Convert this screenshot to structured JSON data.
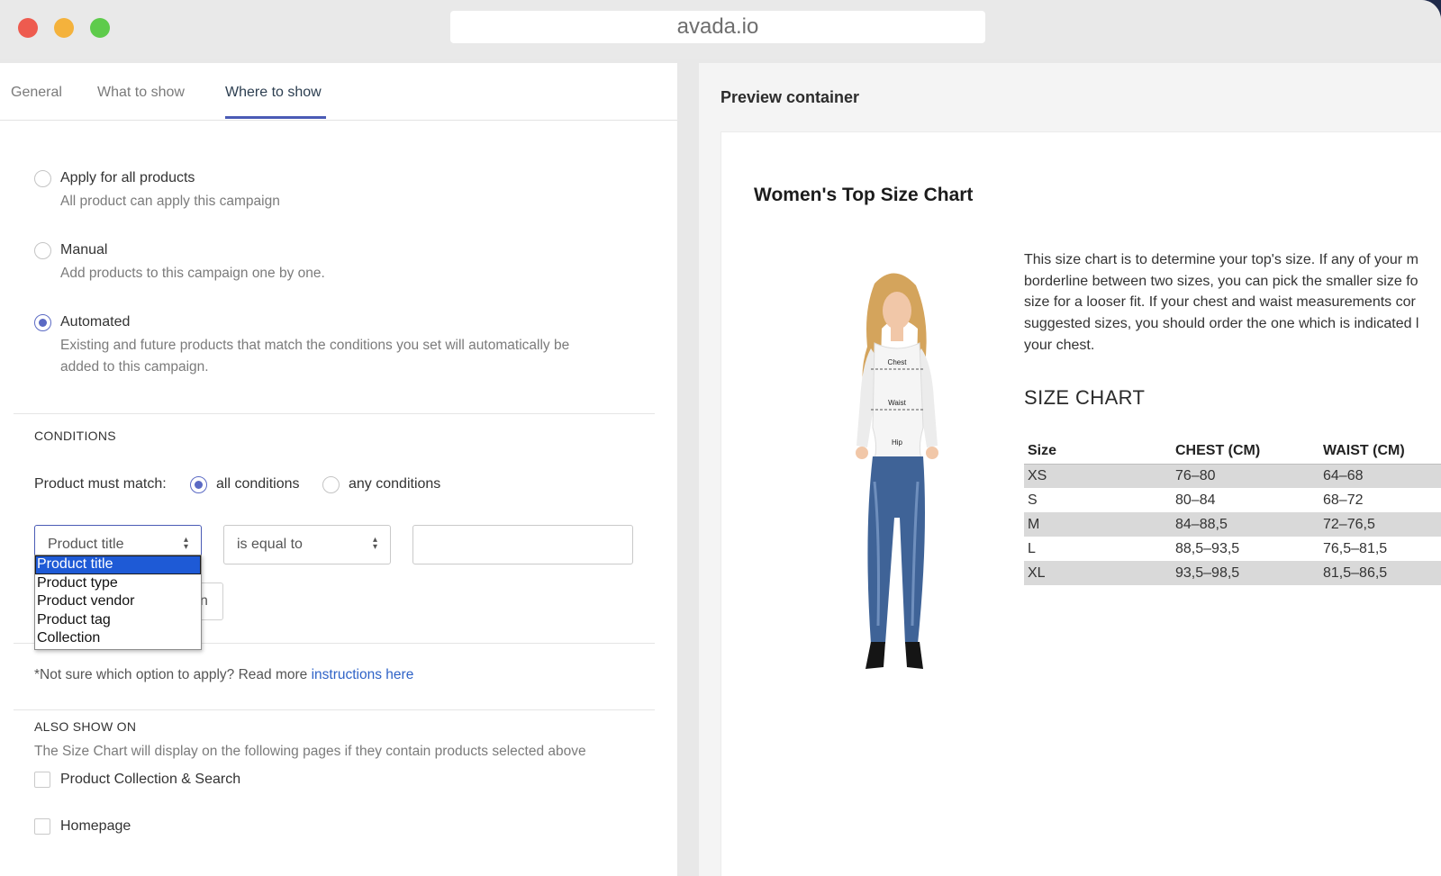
{
  "browser": {
    "url": "avada.io"
  },
  "tabs": [
    {
      "label": "General",
      "active": false
    },
    {
      "label": "What to show",
      "active": false
    },
    {
      "label": "Where to show",
      "active": true
    }
  ],
  "apply_options": [
    {
      "label": "Apply for all products",
      "description": "All product can apply this campaign",
      "selected": false
    },
    {
      "label": "Manual",
      "description": "Add products to this campaign one by one.",
      "selected": false
    },
    {
      "label": "Automated",
      "description_line1": "Existing and future products that match the conditions you set will automatically be",
      "description_line2": "added to this campaign.",
      "selected": true
    }
  ],
  "conditions": {
    "title": "CONDITIONS",
    "match_label": "Product must match:",
    "all_label": "all conditions",
    "any_label": "any conditions",
    "match_value": "all",
    "field_select": "Product title",
    "operator_select": "is equal to",
    "value_input": "",
    "field_options": [
      "Product title",
      "Product type",
      "Product vendor",
      "Product tag",
      "Collection"
    ],
    "hidden_button_fragment": "n",
    "help_text": "*Not sure which option to apply? Read more ",
    "help_link": "instructions here"
  },
  "also_show": {
    "title": "ALSO SHOW ON",
    "description": "The Size Chart will display on the following pages if they contain products selected above",
    "options": [
      {
        "label": "Product Collection & Search",
        "checked": false
      },
      {
        "label": "Homepage",
        "checked": false
      }
    ]
  },
  "preview": {
    "title": "Preview container",
    "chart_title": "Women's Top Size Chart",
    "description_lines": [
      "This size chart is to determine your top's size. If any of your m",
      "borderline between two sizes, you can pick the smaller size fo",
      "size for a looser fit. If your chest and waist measurements cor",
      "suggested sizes, you should order the one which is indicated l",
      "your chest."
    ],
    "size_heading": "SIZE CHART",
    "model_labels": [
      "Chest",
      "Waist",
      "Hip"
    ],
    "table": {
      "headers": [
        "Size",
        "CHEST (CM)",
        "WAIST (CM)"
      ],
      "rows": [
        [
          "XS",
          "76–80",
          "64–68"
        ],
        [
          "S",
          "80–84",
          "68–72"
        ],
        [
          "M",
          "84–88,5",
          "72–76,5"
        ],
        [
          "L",
          "88,5–93,5",
          "76,5–81,5"
        ],
        [
          "XL",
          "93,5–98,5",
          "81,5–86,5"
        ]
      ]
    }
  },
  "colors": {
    "accent": "#4a5bb5",
    "link": "#2f63c7",
    "dropdown_highlight": "#1e5ad6"
  }
}
